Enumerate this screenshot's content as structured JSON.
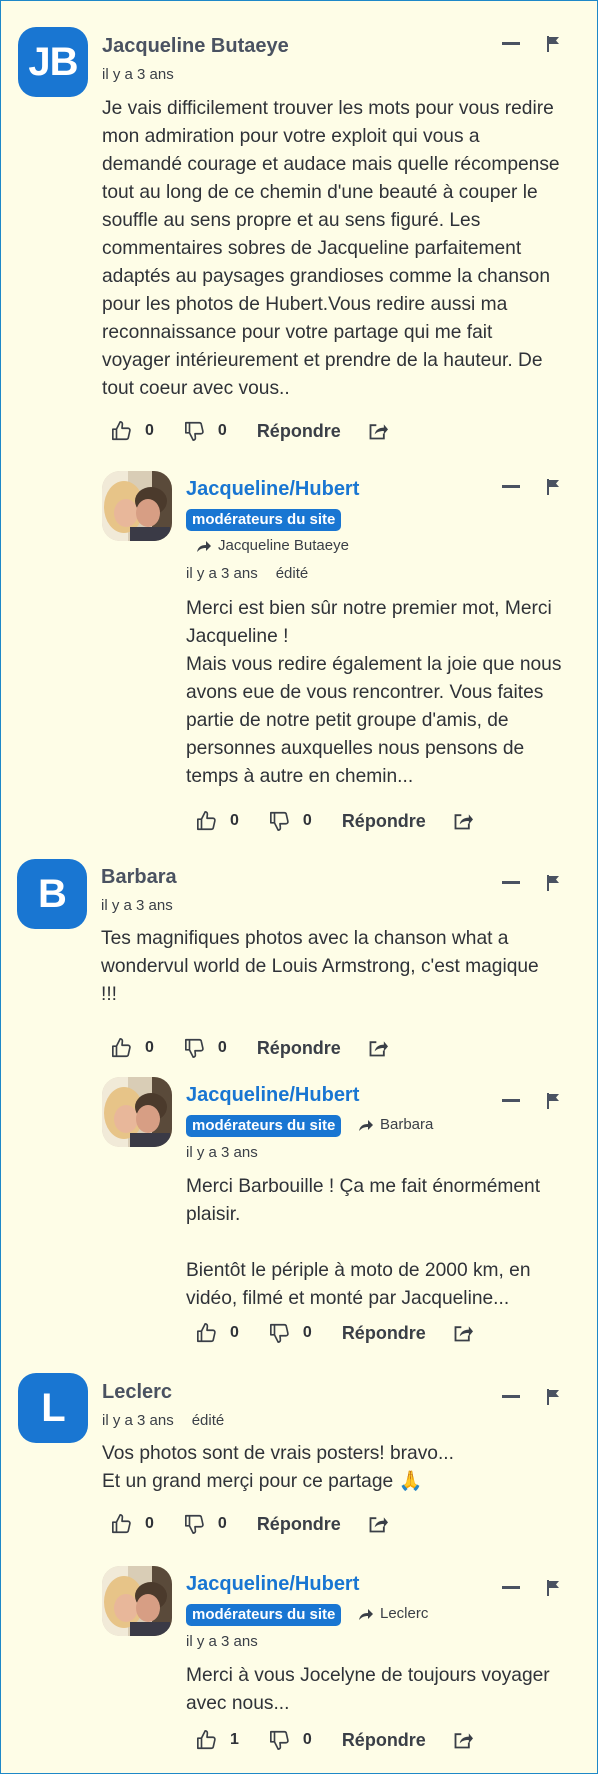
{
  "comments": [
    {
      "initials": "JB",
      "author": "Jacqueline Butaeye",
      "time": "il y a 3 ans",
      "text": "Je vais difficilement trouver les mots pour vous redire\nmon admiration pour votre exploit qui vous a\ndemandé courage et audace mais quelle récompense\ntout au long de ce chemin d'une beauté à couper le\nsouffle au sens propre et au sens figuré. Les\ncommentaires sobres de Jacqueline parfaitement\nadaptés au paysages grandioses comme la chanson\npour les photos de Hubert.Vous redire aussi ma\nreconnaissance pour votre partage qui me fait\nvoyager intérieurement et prendre de la hauteur. De\ntout coeur avec vous..",
      "likes": "0",
      "dislikes": "0",
      "reply_label": "Répondre"
    },
    {
      "author": "Jacqueline/Hubert",
      "badge": "modérateurs du site",
      "reply_to": "Jacqueline Butaeye",
      "time": "il y a 3 ans",
      "edited": "édité",
      "text": "Merci est bien sûr notre premier mot, Merci\nJacqueline !\nMais vous redire également la joie que nous\navons eue de vous rencontrer. Vous faites\npartie de notre petit groupe d'amis, de\npersonnes auxquelles nous pensons de\ntemps à autre en chemin...",
      "likes": "0",
      "dislikes": "0",
      "reply_label": "Répondre"
    },
    {
      "initials": "B",
      "author": "Barbara",
      "time": "il y a 3 ans",
      "text": "Tes magnifiques photos avec la chanson what a\nwondervul world de Louis Armstrong, c'est magique\n!!!",
      "likes": "0",
      "dislikes": "0",
      "reply_label": "Répondre"
    },
    {
      "author": "Jacqueline/Hubert",
      "badge": "modérateurs du site",
      "reply_to": "Barbara",
      "time": "il y a 3 ans",
      "text": "Merci Barbouille ! Ça me fait énormément\nplaisir.\n\nBientôt le périple à moto de 2000 km, en\nvidéo, filmé et monté par Jacqueline...",
      "likes": "0",
      "dislikes": "0",
      "reply_label": "Répondre"
    },
    {
      "initials": "L",
      "author": "Leclerc",
      "time": "il y a 3 ans",
      "edited": "édité",
      "text": "Vos photos sont de vrais posters! bravo...\nEt un grand merçi pour ce partage 🙏",
      "likes": "0",
      "dislikes": "0",
      "reply_label": "Répondre"
    },
    {
      "author": "Jacqueline/Hubert",
      "badge": "modérateurs du site",
      "reply_to": "Leclerc",
      "time": "il y a 3 ans",
      "text": "Merci à vous Jocelyne de toujours voyager\navec nous...",
      "likes": "1",
      "dislikes": "0",
      "reply_label": "Répondre"
    }
  ],
  "colors": {
    "accent": "#1976d2",
    "background": "#fefde7"
  }
}
